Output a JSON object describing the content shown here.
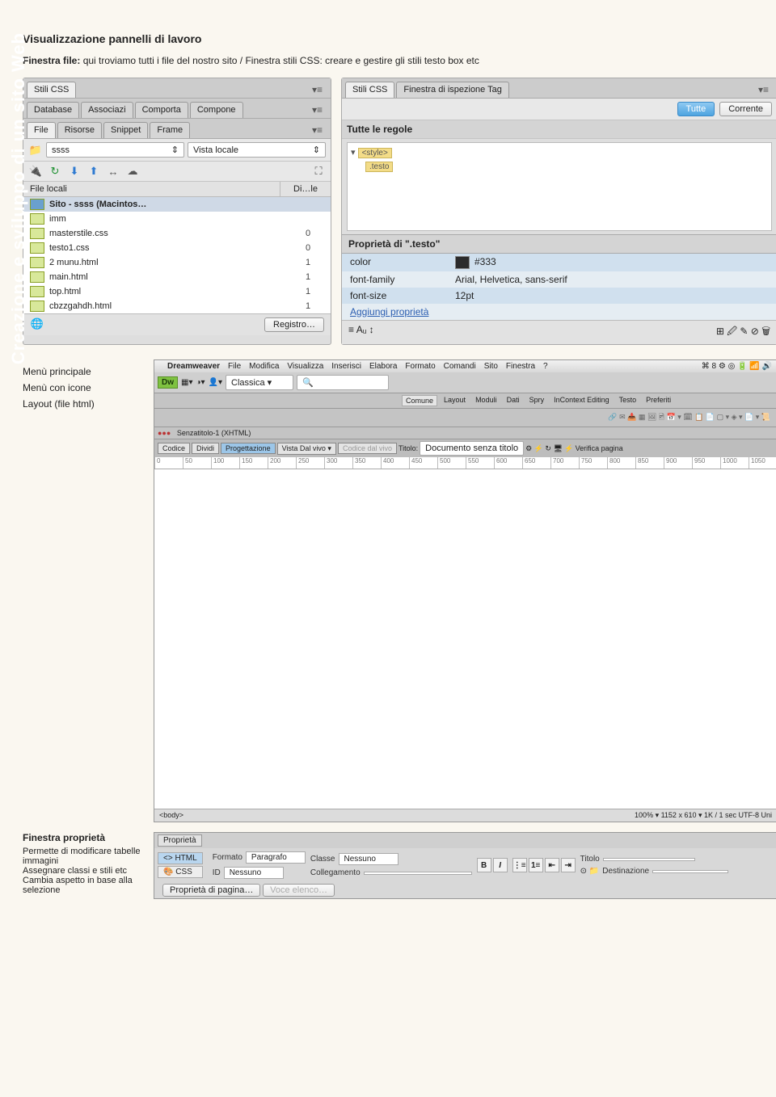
{
  "spine_label": "Creazione e sviluppo di un sito Web",
  "heading": "Visualizzazione pannelli di lavoro",
  "intro_prefix": "Finestra file:",
  "intro_rest": " qui troviamo tutti i file del nostro sito / Finestra stili CSS: creare e gestire gli stili testo box etc",
  "left_panel": {
    "tabs_row1": [
      "Stili CSS"
    ],
    "tabs_row2": [
      "Database",
      "Associazi",
      "Comporta",
      "Compone"
    ],
    "tabs_row3": [
      "File",
      "Risorse",
      "Snippet",
      "Frame"
    ],
    "site_name": "ssss",
    "view_select": "Vista locale",
    "header_col1": "File locali",
    "header_col2": "Di…le",
    "root": "Sito - ssss (Macintos…",
    "files": [
      {
        "name": "imm",
        "size": ""
      },
      {
        "name": "masterstile.css",
        "size": "0"
      },
      {
        "name": "testo1.css",
        "size": "0"
      },
      {
        "name": "2 munu.html",
        "size": "1"
      },
      {
        "name": "main.html",
        "size": "1"
      },
      {
        "name": "top.html",
        "size": "1"
      },
      {
        "name": "cbzzgahdh.html",
        "size": "1"
      }
    ],
    "footer_btn": "Registro…"
  },
  "right_panel": {
    "tabs": [
      "Stili CSS",
      "Finestra di ispezione Tag"
    ],
    "btn_all": "Tutte",
    "btn_current": "Corrente",
    "rules_label": "Tutte le regole",
    "rules": [
      "<style>",
      ".testo"
    ],
    "prop_header": "Proprietà di \".testo\"",
    "props": [
      {
        "name": "color",
        "value": "#333",
        "swatch": true
      },
      {
        "name": "font-family",
        "value": "Arial, Helvetica, sans-serif"
      },
      {
        "name": "font-size",
        "value": "12pt"
      }
    ],
    "add_link": "Aggiungi proprietà",
    "topright_icons": [
      "≡",
      "Aᵤ",
      "↕"
    ],
    "bottomright_icons": [
      "⊞",
      "🖉",
      "✎",
      "⊘",
      "🗑"
    ]
  },
  "mid_labels": [
    "Menù principale",
    "Menù con icone",
    "",
    "Layout (file html)"
  ],
  "dw": {
    "menu": [
      "Dreamweaver",
      "File",
      "Modifica",
      "Visualizza",
      "Inserisci",
      "Elabora",
      "Formato",
      "Comandi",
      "Sito",
      "Finestra",
      "?"
    ],
    "menu_right": "⌘ 8 ⚙ ◎ 🔋 📶 🔊",
    "subtabs": [
      "Comune",
      "Layout",
      "Moduli",
      "Dati",
      "Spry",
      "InContext Editing",
      "Testo",
      "Preferiti"
    ],
    "logo": "Dw",
    "layout_dropdown": "Classica ▾",
    "search_placeholder": "",
    "doc_title": "Senzatitolo-1 (XHTML)",
    "viewtabs": [
      "Codice",
      "Dividi",
      "Progettazione"
    ],
    "live_btn": "Vista Dal vivo ▾",
    "codelive": "Codice dal vivo",
    "title_label": "Titolo:",
    "title_value": "Documento senza titolo",
    "verify": "Verifica pagina",
    "ruler_ticks": [
      "0",
      "50",
      "100",
      "150",
      "200",
      "250",
      "300",
      "350",
      "400",
      "450",
      "500",
      "550",
      "600",
      "650",
      "700",
      "750",
      "800",
      "850",
      "900",
      "950",
      "1000",
      "1050"
    ],
    "status_left": "<body>",
    "status_right": "100% ▾ 1152 x 610 ▾ 1K / 1 sec UTF-8 Uni"
  },
  "prop_section": {
    "heading": "Finestra proprietà",
    "lines": [
      "Permette di modificare tabelle immagini",
      "Assegnare classi e stili etc",
      "Cambia aspetto in base alla selezione"
    ],
    "tab": "Proprietà",
    "mode_html": "<> HTML",
    "mode_css": "🎨 CSS",
    "label_formato": "Formato",
    "val_formato": "Paragrafo",
    "label_id": "ID",
    "val_id": "Nessuno",
    "label_classe": "Classe",
    "val_classe": "Nessuno",
    "label_coll": "Collegamento",
    "label_titolo": "Titolo",
    "label_dest": "Destinazione",
    "btn_pageprops": "Proprietà di pagina…",
    "btn_voceconten": "Voce elenco…"
  }
}
